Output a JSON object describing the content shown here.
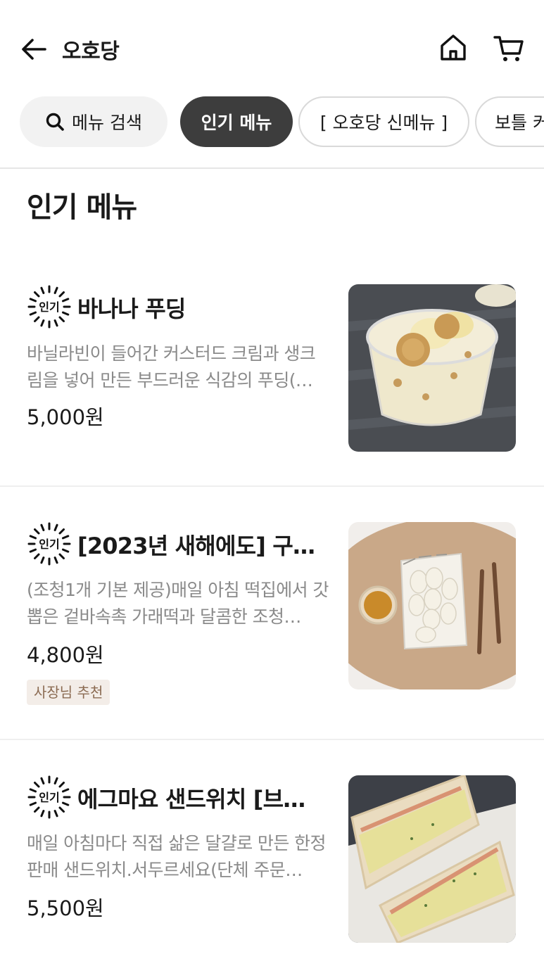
{
  "header": {
    "store_name": "오호당",
    "back_icon": "arrow-left-icon",
    "home_icon": "home-icon",
    "cart_icon": "cart-icon"
  },
  "chips": {
    "search_label": "메뉴 검색",
    "popular_label": "인기 메뉴",
    "new_label": "[ 오호당 신메뉴 ]",
    "bottle_label": "보틀 커"
  },
  "section": {
    "title": "인기 메뉴"
  },
  "badge_text": "인기",
  "items": [
    {
      "name": "바나나 푸딩",
      "description": "바닐라빈이 들어간 커스터드 크림과 생크림을 넣어 만든 부드러운 식감의 푸딩(…",
      "price": "5,000원"
    },
    {
      "name": "[2023년 새해에도] 구…",
      "description": "(조청1개 기본 제공)매일 아침 떡집에서 갓 뽑은 겉바속촉 가래떡과 달콤한 조청…",
      "price": "4,800원",
      "tag": "사장님 추천"
    },
    {
      "name": "에그마요 샌드위치 [브…",
      "description": "매일 아침마다 직접 삶은 달걀로 만든 한정 판매 샌드위치.서두르세요(단체 주문…",
      "price": "5,500원"
    }
  ],
  "colors": {
    "chip_active": "#3d3d3d",
    "tag_bg": "#f3ede8",
    "tag_text": "#8b6b52"
  }
}
